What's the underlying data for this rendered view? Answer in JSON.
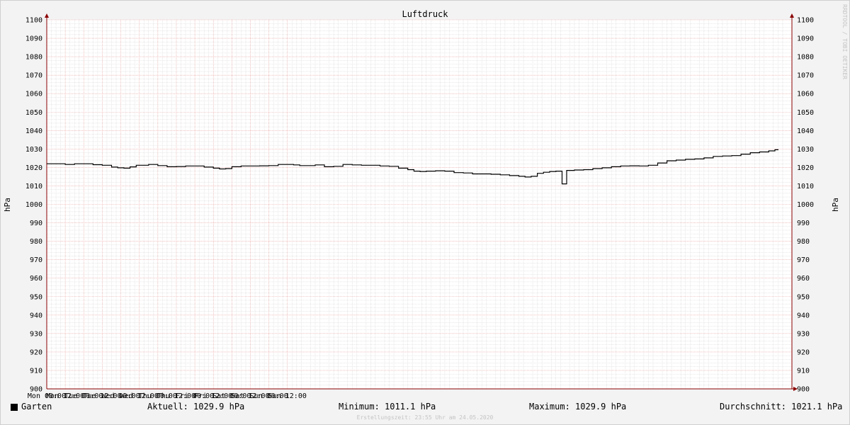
{
  "chart_data": {
    "type": "line",
    "title": "Luftdruck",
    "ylabel": "hPa",
    "ylim": [
      900,
      1100
    ],
    "y_ticks": [
      "900",
      "910",
      "920",
      "930",
      "940",
      "950",
      "960",
      "970",
      "980",
      "990",
      "1000",
      "1010",
      "1020",
      "1030",
      "1040",
      "1050",
      "1060",
      "1070",
      "1080",
      "1090",
      "1100"
    ],
    "x_ticks": [
      "Mon 00:00",
      "Mon 12:00",
      "Tue 00:00",
      "Tue 12:00",
      "Wed 00:00",
      "Wed 12:00",
      "Thu 00:00",
      "Thu 12:00",
      "Fri 00:00",
      "Fri 12:00",
      "Sat 00:00",
      "Sat 12:00",
      "Sun 00:00",
      "Sun 12:00"
    ],
    "x_unit": "hours since Mon 00:00",
    "grid": true,
    "series": [
      {
        "name": "Garten",
        "color": "#000000",
        "points": [
          [
            0,
            1022.0
          ],
          [
            6,
            1022.0
          ],
          [
            12,
            1021.6
          ],
          [
            18,
            1022.0
          ],
          [
            24,
            1022.0
          ],
          [
            30,
            1021.5
          ],
          [
            36,
            1021.2
          ],
          [
            42,
            1020.2
          ],
          [
            46,
            1019.8
          ],
          [
            50,
            1019.6
          ],
          [
            54,
            1020.3
          ],
          [
            58,
            1021.2
          ],
          [
            66,
            1021.6
          ],
          [
            72,
            1021.0
          ],
          [
            78,
            1020.4
          ],
          [
            84,
            1020.5
          ],
          [
            90,
            1020.8
          ],
          [
            96,
            1020.8
          ],
          [
            102,
            1020.2
          ],
          [
            108,
            1019.6
          ],
          [
            112,
            1019.2
          ],
          [
            116,
            1019.4
          ],
          [
            120,
            1020.4
          ],
          [
            126,
            1020.8
          ],
          [
            132,
            1020.8
          ],
          [
            138,
            1020.9
          ],
          [
            144,
            1021.0
          ],
          [
            150,
            1021.6
          ],
          [
            156,
            1021.6
          ],
          [
            160,
            1021.4
          ],
          [
            164,
            1021.0
          ],
          [
            168,
            1021.0
          ],
          [
            174,
            1021.4
          ],
          [
            180,
            1020.4
          ],
          [
            186,
            1020.6
          ],
          [
            192,
            1021.6
          ],
          [
            198,
            1021.4
          ],
          [
            204,
            1021.2
          ],
          [
            210,
            1021.2
          ],
          [
            216,
            1020.8
          ],
          [
            222,
            1020.6
          ],
          [
            228,
            1019.6
          ],
          [
            234,
            1018.8
          ],
          [
            238,
            1018.0
          ],
          [
            242,
            1017.8
          ],
          [
            246,
            1018.0
          ],
          [
            252,
            1018.2
          ],
          [
            258,
            1018.0
          ],
          [
            264,
            1017.2
          ],
          [
            270,
            1017.0
          ],
          [
            276,
            1016.5
          ],
          [
            282,
            1016.5
          ],
          [
            288,
            1016.3
          ],
          [
            294,
            1016.0
          ],
          [
            300,
            1015.6
          ],
          [
            306,
            1015.2
          ],
          [
            310,
            1014.8
          ],
          [
            314,
            1015.2
          ],
          [
            318,
            1016.8
          ],
          [
            322,
            1017.4
          ],
          [
            326,
            1017.8
          ],
          [
            330,
            1018.0
          ],
          [
            333,
            1018.0
          ],
          [
            334,
            1011.1
          ],
          [
            336,
            1011.1
          ],
          [
            337,
            1018.4
          ],
          [
            342,
            1018.6
          ],
          [
            348,
            1018.8
          ],
          [
            354,
            1019.4
          ],
          [
            360,
            1019.8
          ],
          [
            366,
            1020.4
          ],
          [
            372,
            1020.8
          ],
          [
            378,
            1020.9
          ],
          [
            384,
            1020.8
          ],
          [
            390,
            1021.2
          ],
          [
            396,
            1022.4
          ],
          [
            402,
            1023.6
          ],
          [
            408,
            1024.0
          ],
          [
            414,
            1024.4
          ],
          [
            420,
            1024.6
          ],
          [
            426,
            1025.2
          ],
          [
            432,
            1026.0
          ],
          [
            438,
            1026.2
          ],
          [
            444,
            1026.4
          ],
          [
            450,
            1027.2
          ],
          [
            456,
            1028.0
          ],
          [
            462,
            1028.4
          ],
          [
            468,
            1029.0
          ],
          [
            472,
            1029.6
          ],
          [
            474,
            1029.9
          ]
        ]
      }
    ],
    "legend": {
      "series_label": "Garten",
      "current": "Aktuell: 1029.9 hPa",
      "minimum": "Minimum: 1011.1 hPa",
      "maximum": "Maximum: 1029.9 hPa",
      "average": "Durchschnitt: 1021.1 hPa"
    },
    "footer": "Erstellungszeit: 23:55 Uhr am 24.05.2020",
    "watermark": "RRDTOOL / TOBI OETIKER",
    "colors": {
      "background": "#f3f3f3",
      "plot_background": "#ffffff",
      "major_grid": "#e79b9b",
      "minor_grid": "#d0d0d0",
      "axis": "#8b0000",
      "line": "#000000"
    }
  }
}
